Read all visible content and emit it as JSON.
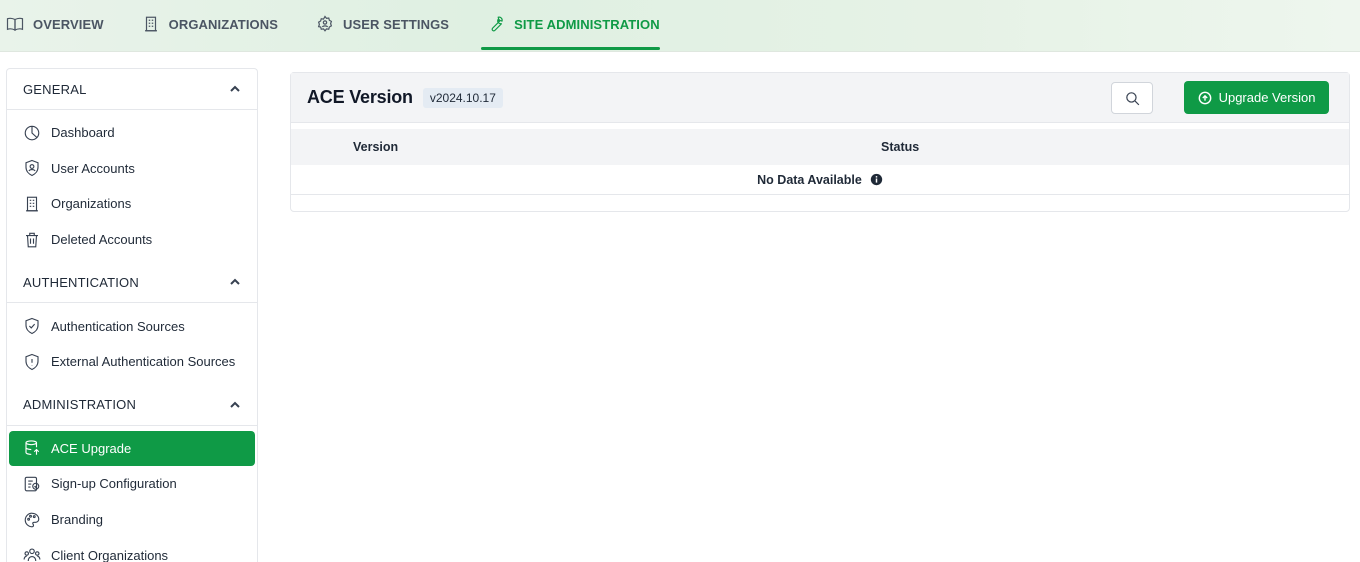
{
  "topnav": {
    "tabs": [
      {
        "label": "OVERVIEW",
        "icon": "book-icon"
      },
      {
        "label": "ORGANIZATIONS",
        "icon": "building-icon"
      },
      {
        "label": "USER SETTINGS",
        "icon": "user-gear-icon"
      },
      {
        "label": "SITE ADMINISTRATION",
        "icon": "wrench-icon",
        "active": true
      }
    ]
  },
  "sidebar": {
    "sections": [
      {
        "title": "GENERAL",
        "items": [
          {
            "label": "Dashboard",
            "icon": "pie-chart-icon"
          },
          {
            "label": "User Accounts",
            "icon": "user-shield-icon"
          },
          {
            "label": "Organizations",
            "icon": "building-icon"
          },
          {
            "label": "Deleted Accounts",
            "icon": "trash-icon"
          }
        ]
      },
      {
        "title": "AUTHENTICATION",
        "items": [
          {
            "label": "Authentication Sources",
            "icon": "shield-check-icon"
          },
          {
            "label": "External Authentication Sources",
            "icon": "shield-alert-icon"
          }
        ]
      },
      {
        "title": "ADMINISTRATION",
        "items": [
          {
            "label": "ACE Upgrade",
            "icon": "database-upgrade-icon",
            "active": true
          },
          {
            "label": "Sign-up Configuration",
            "icon": "form-check-icon"
          },
          {
            "label": "Branding",
            "icon": "palette-icon"
          },
          {
            "label": "Client Organizations",
            "icon": "users-group-icon"
          }
        ]
      }
    ]
  },
  "main": {
    "title": "ACE Version",
    "version": "v2024.10.17",
    "upgrade_label": "Upgrade Version",
    "table": {
      "columns": [
        "Version",
        "Status"
      ],
      "empty_message": "No Data Available"
    }
  },
  "colors": {
    "accent": "#0f9a46",
    "nav_bg": "#e3f1e5",
    "header_bg": "#f3f4f6"
  }
}
